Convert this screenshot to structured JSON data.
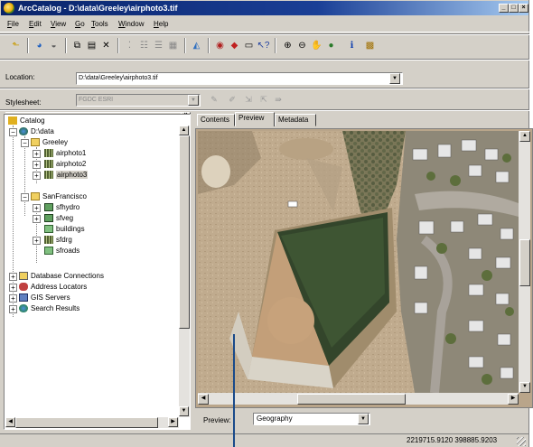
{
  "window": {
    "title": "ArcCatalog - D:\\data\\Greeley\\airphoto3.tif",
    "caption_buttons": [
      "_",
      "□",
      "×"
    ]
  },
  "menu": {
    "file": {
      "key": "F",
      "rest": "ile"
    },
    "edit": {
      "key": "E",
      "rest": "dit"
    },
    "view": {
      "key": "V",
      "rest": "iew"
    },
    "go": {
      "key": "G",
      "rest": "o"
    },
    "tools": {
      "key": "T",
      "rest": "ools"
    },
    "window": {
      "key": "W",
      "rest": "indow"
    },
    "help": {
      "key": "H",
      "rest": "elp"
    }
  },
  "toolbar": {
    "icons": [
      "up-one-level-icon",
      "connect-folder-icon",
      "disconnect-folder-icon",
      "copy-icon",
      "paste-icon",
      "delete-icon",
      "large-icons-icon",
      "list-icon",
      "details-icon",
      "thumbnails-icon",
      "launch-arcmap-icon",
      "arctoolbox-icon",
      "metadata-icon",
      "search-icon",
      "whats-this-icon",
      "zoom-in-icon",
      "zoom-out-icon",
      "pan-icon",
      "full-extent-icon",
      "identify-icon",
      "create-thumbnail-icon"
    ]
  },
  "location": {
    "label": "Location:",
    "value": "D:\\data\\Greeley\\airphoto3.tif"
  },
  "stylesheet": {
    "label": "Stylesheet:",
    "value": "FGDC ESRI"
  },
  "tree": {
    "catalog": "Catalog",
    "ddata": "D:\\data",
    "greeley": "Greeley",
    "airphoto1": "airphoto1",
    "airphoto2": "airphoto2",
    "airphoto3": "airphoto3",
    "sanfrancisco": "SanFrancisco",
    "sfhydro": "sfhydro",
    "sfveg": "sfveg",
    "buildings": "buildings",
    "sfdrg": "sfdrg",
    "sfroads": "sfroads",
    "dbconn": "Database Connections",
    "addrloc": "Address Locators",
    "gisservers": "GIS Servers",
    "searchresults": "Search Results"
  },
  "tabs": {
    "contents": "Contents",
    "preview": "Preview",
    "metadata": "Metadata"
  },
  "preview": {
    "label": "Preview:",
    "value": "Geography"
  },
  "status": {
    "coords": "2219715.9120  398885.9203"
  }
}
